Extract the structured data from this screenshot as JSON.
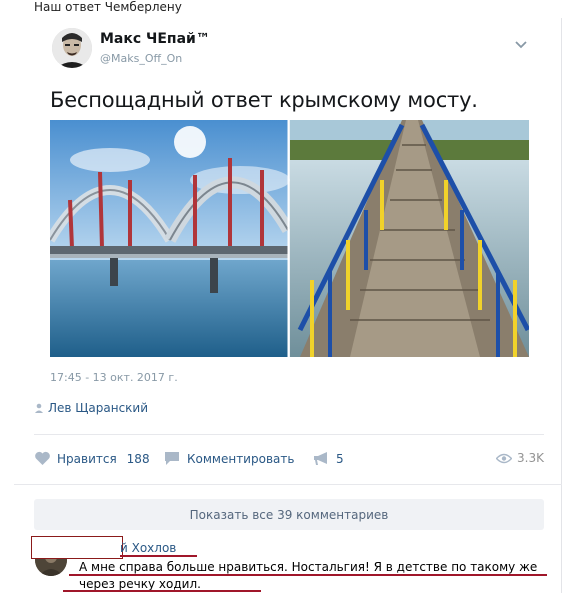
{
  "post": {
    "title": "Наш ответ Чемберлену",
    "tweet": {
      "author_name": "Макс ЧЕпай™",
      "author_handle": "@Maks_Off_On",
      "text": "Беспощадный ответ крымскому мосту.",
      "timestamp": "17:45 - 13 окт. 2017 г."
    },
    "repost_author": "Лев Щаранский",
    "actions": {
      "like_label": "Нравится",
      "like_count": "188",
      "comment_label": "Комментировать",
      "share_count": "5",
      "views": "3.3K"
    }
  },
  "comments": {
    "show_all_label": "Показать все 39 комментариев",
    "items": [
      {
        "author_partial": "й Хохлов",
        "text": "А мне справа больше нравиться. Ностальгия! Я в детстве по такому же через речку ходил."
      }
    ]
  },
  "icons": {
    "like": "heart-icon",
    "comment": "comment-icon",
    "share": "megaphone-icon",
    "views": "eye-icon",
    "repost": "person-icon",
    "menu": "chevron-down-icon"
  },
  "colors": {
    "link": "#2a5885",
    "muted": "#939393",
    "button_bg": "#f0f2f5",
    "annotation_red": "#a0162a"
  }
}
